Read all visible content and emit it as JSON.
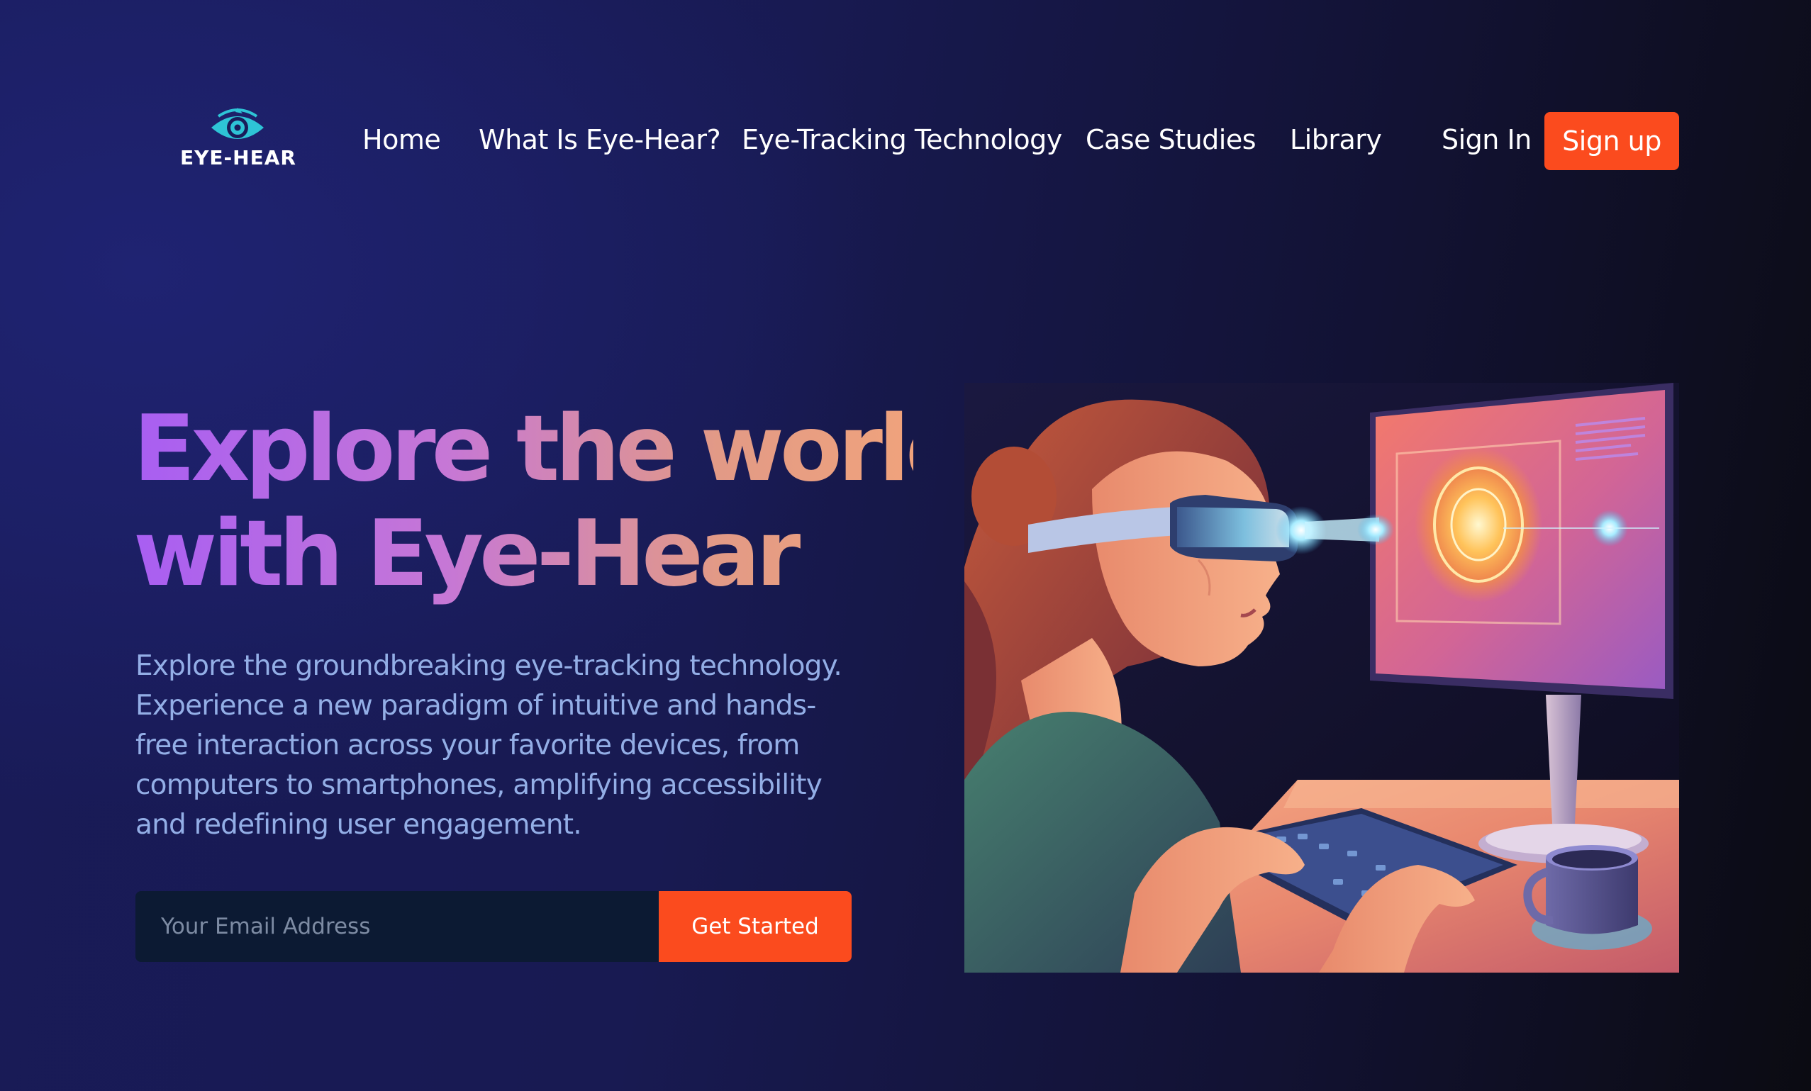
{
  "brand": {
    "name": "EYE-HEAR",
    "accent_color": "#fb4b1e",
    "logo_icon": "eye-icon",
    "logo_color": "#2ec4d6"
  },
  "nav": {
    "links": [
      "Home",
      "What Is Eye-Hear?",
      "Eye-Tracking Technology",
      "Case Studies",
      "Library"
    ],
    "sign_in": "Sign In",
    "sign_up": "Sign up"
  },
  "hero": {
    "headline_line1": "Explore the world",
    "headline_line2": "with Eye-Hear",
    "subtext": "Explore the groundbreaking eye-tracking technology. Experience a new paradigm of intuitive and hands-free interaction across your favorite devices, from computers to smartphones, amplifying accessibility and redefining user engagement.",
    "illustration": "woman-vr-headset-illustration"
  },
  "signup_form": {
    "email_placeholder": "Your Email Address",
    "email_value": "",
    "cta_label": "Get Started"
  }
}
